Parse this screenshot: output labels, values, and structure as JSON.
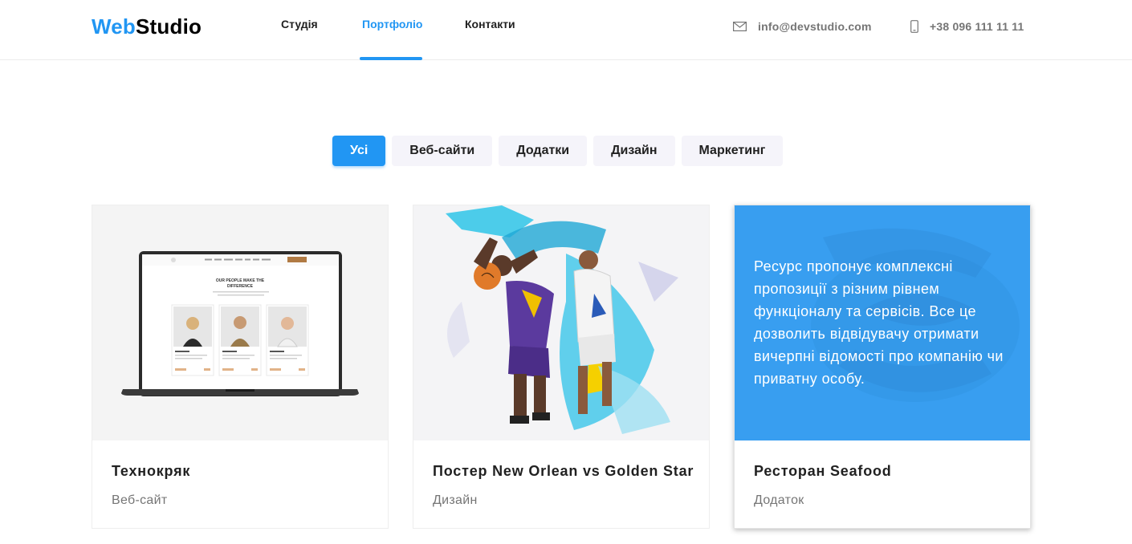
{
  "header": {
    "logo": {
      "part1": "Web",
      "part2": "Studio"
    },
    "nav": [
      {
        "label": "Студія",
        "active": false
      },
      {
        "label": "Портфоліо",
        "active": true
      },
      {
        "label": "Контакти",
        "active": false
      }
    ],
    "email": "info@devstudio.com",
    "phone": "+38 096 111 11 11",
    "icons": {
      "email": "envelope-icon",
      "phone": "smartphone-icon"
    }
  },
  "filters": [
    {
      "label": "Усі",
      "active": true
    },
    {
      "label": "Веб-сайти",
      "active": false
    },
    {
      "label": "Додатки",
      "active": false
    },
    {
      "label": "Дизайн",
      "active": false
    },
    {
      "label": "Маркетинг",
      "active": false
    }
  ],
  "cards": [
    {
      "title": "Технокряк",
      "category": "Веб-сайт",
      "image": "laptop-mockup",
      "mockup_heading": "OUR PEOPLE MAKE THE DIFFERENCE"
    },
    {
      "title": "Постер New Orlean vs Golden Star",
      "category": "Дизайн",
      "image": "basketball-poster"
    },
    {
      "title": "Ресторан Seafood",
      "category": "Додаток",
      "image": "seafood-logo",
      "overlay_text": "Ресурс пропонує комплексні пропозиції з різним рівнем функціоналу та сервісів. Все це дозволить відвідувачу отримати вичерпні відомості про компанію чи приватну особу."
    }
  ],
  "colors": {
    "accent": "#2196f3",
    "overlay": "#389ef0",
    "filter_bg": "#f5f4fa",
    "text": "#212121",
    "muted": "#757575"
  }
}
